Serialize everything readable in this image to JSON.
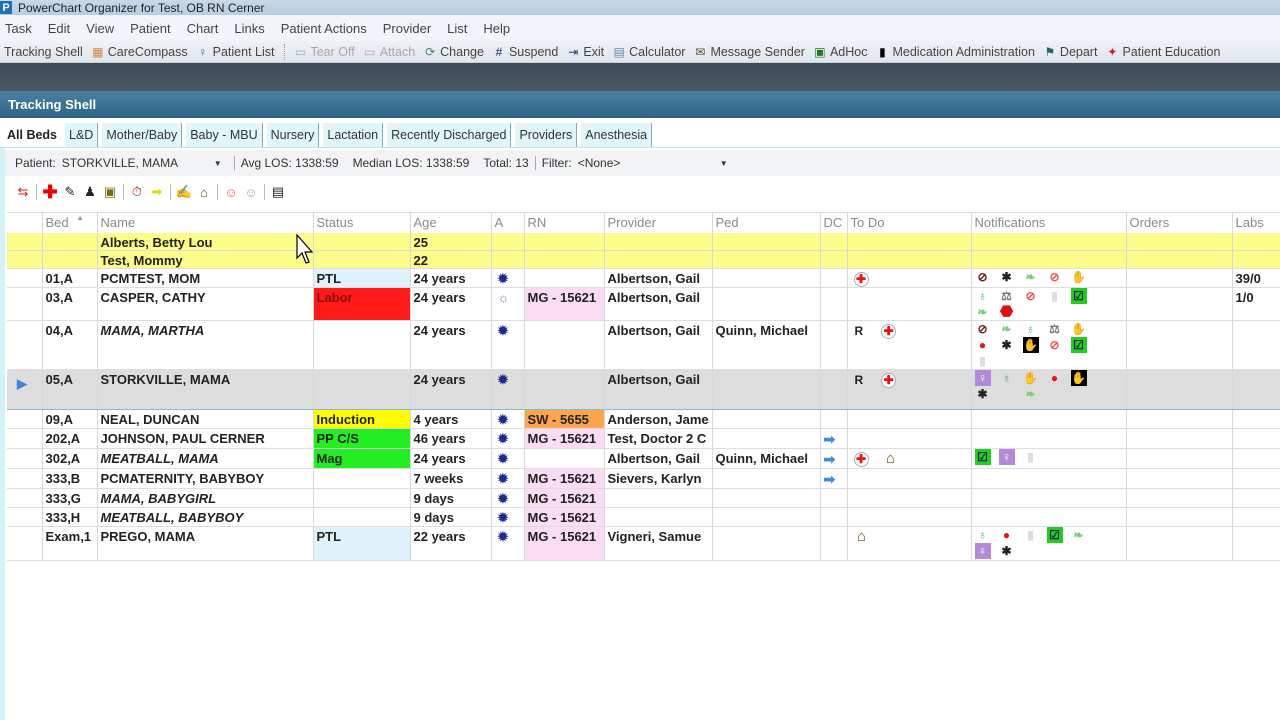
{
  "window": {
    "title": "PowerChart Organizer for Test, OB RN Cerner",
    "logo": "P"
  },
  "menu": [
    "Task",
    "Edit",
    "View",
    "Patient",
    "Chart",
    "Links",
    "Patient Actions",
    "Provider",
    "List",
    "Help"
  ],
  "toolbar": [
    {
      "label": "Tracking Shell",
      "icon": "",
      "disabled": false
    },
    {
      "label": "CareCompass",
      "icon": "carecompass-icon",
      "disabled": false
    },
    {
      "label": "Patient List",
      "icon": "person-icon",
      "disabled": false
    },
    {
      "label": "Tear Off",
      "icon": "tear-off-icon",
      "disabled": true
    },
    {
      "label": "Attach",
      "icon": "attach-icon",
      "disabled": true
    },
    {
      "label": "Change",
      "icon": "change-icon",
      "disabled": false
    },
    {
      "label": "Suspend",
      "icon": "suspend-icon",
      "disabled": false
    },
    {
      "label": "Exit",
      "icon": "exit-icon",
      "disabled": false
    },
    {
      "label": "Calculator",
      "icon": "calculator-icon",
      "disabled": false
    },
    {
      "label": "Message Sender",
      "icon": "message-sender-icon",
      "disabled": false
    },
    {
      "label": "AdHoc",
      "icon": "adhoc-icon",
      "disabled": false
    },
    {
      "label": "Medication Administration",
      "icon": "barcode-icon",
      "disabled": false
    },
    {
      "label": "Depart",
      "icon": "depart-icon",
      "disabled": false
    },
    {
      "label": "Patient Education",
      "icon": "patient-education-icon",
      "disabled": false
    }
  ],
  "shell": {
    "title": "Tracking Shell"
  },
  "tabs": [
    "All Beds",
    "L&D",
    "Mother/Baby",
    "Baby - MBU",
    "Nursery",
    "Lactation",
    "Recently Discharged",
    "Providers",
    "Anesthesia"
  ],
  "active_tab": "All Beds",
  "patient_bar": {
    "patient_label": "Patient:",
    "patient_value": "STORKVILLE, MAMA",
    "avg_los": "Avg LOS: 1338:59",
    "median_los": "Median LOS: 1338:59",
    "total": "Total: 13",
    "filter_label": "Filter:",
    "filter_value": "<None>"
  },
  "grid": {
    "columns": [
      "",
      "Bed",
      "Name",
      "Status",
      "Age",
      "A",
      "RN",
      "Provider",
      "Ped",
      "DC",
      "To Do",
      "Notifications",
      "Orders",
      "Labs"
    ],
    "rows": [
      {
        "bed": "",
        "name": "Alberts, Betty Lou",
        "status": "",
        "age": "25",
        "acuity": "",
        "rn": "",
        "provider": "",
        "ped": "",
        "dc": "",
        "todo": [],
        "notifications": [],
        "orders": "",
        "labs": "",
        "style": "yellow"
      },
      {
        "bed": "",
        "name": "Test, Mommy",
        "status": "",
        "age": "22",
        "acuity": "",
        "rn": "",
        "provider": "",
        "ped": "",
        "dc": "",
        "todo": [],
        "notifications": [],
        "orders": "",
        "labs": "",
        "style": "yellow"
      },
      {
        "bed": "01,A",
        "name": "PCMTEST, MOM",
        "status": "PTL",
        "age": "24 years",
        "acuity": "sun",
        "rn": "",
        "provider": "Albertson, Gail",
        "ped": "",
        "dc": "",
        "todo": [
          "medical-cross"
        ],
        "notifications": [
          [
            "no-smoking",
            "bee",
            "leaf",
            "prohibited",
            "gloves"
          ]
        ],
        "orders": "",
        "labs": "39/0"
      },
      {
        "bed": "03,A",
        "name": "CASPER, CATHY",
        "status": "Labor",
        "age": "24 years",
        "acuity": "sun-light",
        "rn": "MG - 15621",
        "provider": "Albertson, Gail",
        "ped": "",
        "dc": "",
        "todo": [],
        "notifications": [
          [
            "bottle-blue",
            "scale",
            "prohibited",
            "bottle",
            "checklist"
          ],
          [
            "leaf",
            "stop"
          ]
        ],
        "orders": "",
        "labs": "1/0"
      },
      {
        "bed": "04,A",
        "name": "MAMA, MARTHA",
        "italic": true,
        "status": "",
        "age": "24 years",
        "acuity": "sun",
        "rn": "",
        "provider": "Albertson, Gail",
        "ped": "Quinn, Michael",
        "dc": "",
        "todo": [
          "R",
          "medical-cross"
        ],
        "notifications": [
          [
            "no-smoking",
            "leaf",
            "bottle-blue",
            "scale",
            "gloves"
          ],
          [
            "apple",
            "bee",
            "hand",
            "prohibited",
            "checklist"
          ],
          [
            "bottle"
          ]
        ],
        "orders": "",
        "labs": ""
      },
      {
        "bed": "05,A",
        "name": "STORKVILLE, MAMA",
        "status": "",
        "age": "24 years",
        "acuity": "sun",
        "rn": "",
        "provider": "Albertson, Gail",
        "ped": "",
        "dc": "",
        "todo": [
          "R",
          "medical-cross"
        ],
        "notifications": [
          [
            "pregnancy",
            "bottle-blue",
            "gloves",
            "apple",
            "hand"
          ],
          [
            "bee",
            "bottle",
            "leaf"
          ]
        ],
        "orders": "",
        "labs": "",
        "style": "selected"
      },
      {
        "bed": "09,A",
        "name": "NEAL, DUNCAN",
        "status": "Induction",
        "age": "4 years",
        "acuity": "sun",
        "rn": "SW - 5655",
        "provider": "Anderson, Jame",
        "ped": "",
        "dc": "",
        "todo": [],
        "notifications": [],
        "orders": "",
        "labs": ""
      },
      {
        "bed": "202,A",
        "name": "JOHNSON, PAUL CERNER",
        "status": "PP C/S",
        "age": "46 years",
        "acuity": "sun",
        "rn": "MG - 15621",
        "provider": "Test, Doctor 2 C",
        "ped": "",
        "dc": "arrow",
        "todo": [],
        "notifications": [],
        "orders": "",
        "labs": ""
      },
      {
        "bed": "302,A",
        "name": "MEATBALL, MAMA",
        "italic": true,
        "status": "Mag",
        "age": "24 years",
        "acuity": "sun",
        "rn": "",
        "provider": "Albertson, Gail",
        "ped": "Quinn, Michael",
        "dc": "arrow",
        "todo": [
          "medical-cross",
          "house"
        ],
        "notifications": [
          [
            "checklist",
            "pregnancy",
            "bottle"
          ]
        ],
        "orders": "",
        "labs": ""
      },
      {
        "bed": "333,B",
        "name": "PCMATERNITY, BABYBOY",
        "status": "",
        "age": "7 weeks",
        "acuity": "sun",
        "rn": "MG - 15621",
        "provider": "Sievers, Karlyn",
        "ped": "",
        "dc": "arrow",
        "todo": [],
        "notifications": [],
        "orders": "",
        "labs": ""
      },
      {
        "bed": "333,G",
        "name": "MAMA, BABYGIRL",
        "italic": true,
        "status": "",
        "age": "9 days",
        "acuity": "sun",
        "rn": "MG - 15621",
        "provider": "",
        "ped": "",
        "dc": "",
        "todo": [],
        "notifications": [],
        "orders": "",
        "labs": ""
      },
      {
        "bed": "333,H",
        "name": "MEATBALL, BABYBOY",
        "italic": true,
        "status": "",
        "age": "9 days",
        "acuity": "sun",
        "rn": "MG - 15621",
        "provider": "",
        "ped": "",
        "dc": "",
        "todo": [],
        "notifications": [],
        "orders": "",
        "labs": ""
      },
      {
        "bed": "Exam,1",
        "name": "PREGO, MAMA",
        "status": "PTL",
        "age": "22 years",
        "acuity": "sun",
        "rn": "MG - 15621",
        "provider": "Vigneri, Samue",
        "ped": "",
        "dc": "",
        "todo": [
          "house"
        ],
        "notifications": [
          [
            "bottle-blue",
            "apple",
            "bottle",
            "checklist",
            "leaf"
          ],
          [
            "pregnancy",
            "bee"
          ]
        ],
        "orders": "",
        "labs": ""
      }
    ]
  },
  "status_colors": {
    "PTL": "#dff1fb",
    "Labor": "#ff1a1a",
    "Induction": "#ffff00",
    "PP C/S": "#22ee22",
    "Mag": "#22ee22"
  },
  "rn_colors": {
    "MG - 15621": "#fadcf3",
    "SW - 5655": "#fba54c"
  }
}
